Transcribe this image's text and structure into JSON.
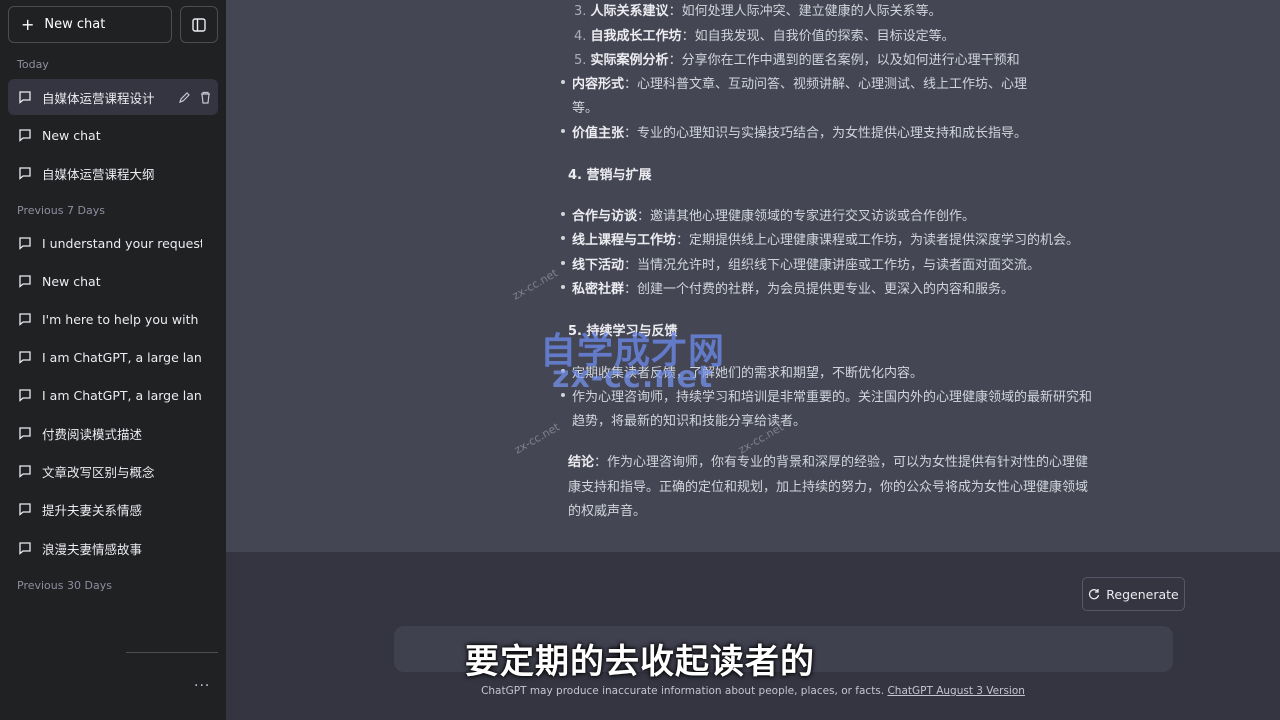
{
  "sidebar": {
    "new_chat": "New chat",
    "sections": {
      "today": "Today",
      "prev7": "Previous 7 Days",
      "prev30": "Previous 30 Days"
    },
    "today_items": [
      "自媒体运营课程设计",
      "New chat",
      "自媒体运营课程大纲"
    ],
    "prev7_items": [
      "I understand your request. Ple",
      "New chat",
      "I'm here to help you with your c",
      "I am ChatGPT, a large languag",
      "I am ChatGPT, a large languag",
      "付费阅读模式描述",
      "文章改写区别与概念",
      "提升夫妻关系情感",
      "浪漫夫妻情感故事"
    ],
    "more": "···"
  },
  "content": {
    "l1_num": "3.",
    "l1_bold": "人际关系建议",
    "l1_text": "：如何处理人际冲突、建立健康的人际关系等。",
    "l2_num": "4.",
    "l2_bold": "自我成长工作坊",
    "l2_text": "：如自我发现、自我价值的探索、目标设定等。",
    "l3_num": "5.",
    "l3_bold": "实际案例分析",
    "l3_text": "：分享你在工作中遇到的匿名案例，以及如何进行心理干预和",
    "l4_bold": "内容形式",
    "l4_text": "：心理科普文章、互动问答、视频讲解、心理测试、线上工作坊、心理",
    "l4_cont": "等。",
    "l5_bold": "价值主张",
    "l5_text": "：专业的心理知识与实操技巧结合，为女性提供心理支持和成长指导。",
    "h4": "4. 营销与扩展",
    "m1_bold": "合作与访谈",
    "m1_text": "：邀请其他心理健康领域的专家进行交叉访谈或合作创作。",
    "m2_bold": "线上课程与工作坊",
    "m2_text": "：定期提供线上心理健康课程或工作坊，为读者提供深度学习的机会。",
    "m3_bold": "线下活动",
    "m3_text": "：当情况允许时，组织线下心理健康讲座或工作坊，与读者面对面交流。",
    "m4_bold": "私密社群",
    "m4_text": "：创建一个付费的社群，为会员提供更专业、更深入的内容和服务。",
    "h5": "5. 持续学习与反馈",
    "f1": "定期收集读者反馈，了解她们的需求和期望，不断优化内容。",
    "f2": "作为心理咨询师，持续学习和培训是非常重要的。关注国内外的心理健康领域的最新研究和",
    "f2_cont": "趋势，将最新的知识和技能分享给读者。",
    "c_bold": "结论",
    "c_text1": "：作为心理咨询师，你有专业的背景和深厚的经验，可以为女性提供有针对性的心理健",
    "c_text2": "康支持和指导。正确的定位和规划，加上持续的努力，你的公众号将成为女性心理健康领域",
    "c_text3": "的权威声音。"
  },
  "bottom": {
    "regenerate": "Regenerate",
    "footer_text": "ChatGPT may produce inaccurate information about people, places, or facts. ",
    "footer_link": "ChatGPT August 3 Version"
  },
  "overlay": {
    "watermark_cn": "自学成才网",
    "watermark_en": "zx-cc.net",
    "watermark_small": "zx-cc.net",
    "subtitle": "要定期的去收起读者的"
  }
}
